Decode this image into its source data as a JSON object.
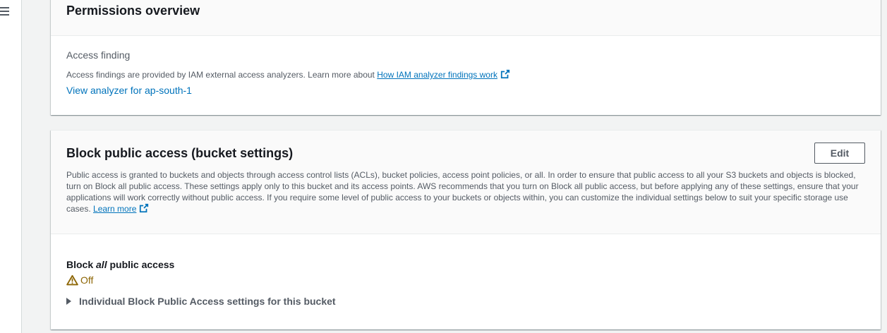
{
  "nav": {
    "menu_icon": "hamburger-menu-icon"
  },
  "permissions_overview": {
    "title": "Permissions overview",
    "access_finding_label": "Access finding",
    "description_prefix": "Access findings are provided by IAM external access analyzers. Learn more about",
    "learn_more_link": "How IAM analyzer findings work",
    "view_analyzer_link": "View analyzer for ap-south-1",
    "external_icon": "external-link-icon"
  },
  "block_public_access": {
    "title": "Block public access (bucket settings)",
    "edit_label": "Edit",
    "description": "Public access is granted to buckets and objects through access control lists (ACLs), bucket policies, access point policies, or all. In order to ensure that public access to all your S3 buckets and objects is blocked, turn on Block all public access. These settings apply only to this bucket and its access points. AWS recommends that you turn on Block all public access, but before applying any of these settings, ensure that your applications will work correctly without public access. If you require some level of public access to your buckets or objects within, you can customize the individual settings below to suit your specific storage use cases.",
    "learn_more_link": "Learn more",
    "block_all_label_prefix": "Block",
    "block_all_label_emph": "all",
    "block_all_label_suffix": "public access",
    "status": "Off",
    "status_icon": "warning-icon",
    "status_color": "#8d6605",
    "expander_label": "Individual Block Public Access settings for this bucket",
    "expander_icon": "caret-right-icon"
  },
  "colors": {
    "link": "#0073bb",
    "text": "#16191f",
    "secondary_text": "#545b64",
    "background": "#f2f3f3"
  }
}
